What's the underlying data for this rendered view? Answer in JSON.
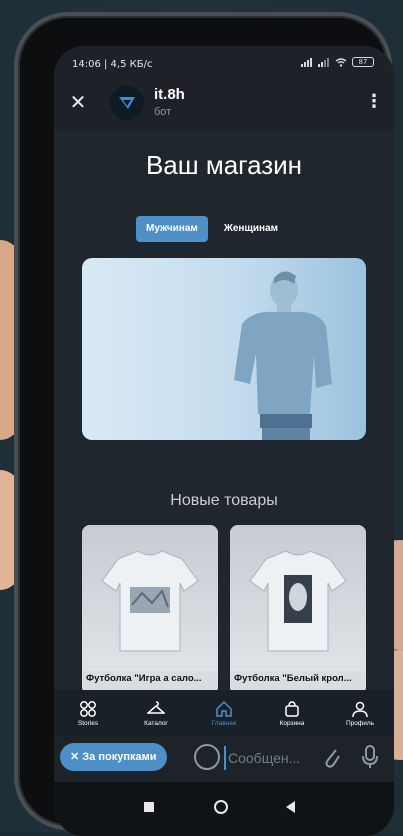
{
  "status_bar": {
    "time": "14:06 | 4,5 КБ/с",
    "battery": "87"
  },
  "header": {
    "bot_name": "it.8h",
    "bot_subtitle": "бот"
  },
  "shop": {
    "title": "Ваш магазин",
    "tabs": [
      {
        "label": "Мужчинам",
        "active": true
      },
      {
        "label": "Женщинам",
        "active": false
      }
    ],
    "section_title": "Новые товары",
    "products": [
      {
        "name": "Футболка \"Игра а сало...",
        "icon": "tshirt-image"
      },
      {
        "name": "Футболка \"Белый крол...",
        "icon": "tshirt-image"
      }
    ]
  },
  "bottom_nav": {
    "items": [
      {
        "label": "Stories",
        "icon": "grid-icon",
        "active": false
      },
      {
        "label": "Каталог",
        "icon": "hanger-icon",
        "active": false
      },
      {
        "label": "Главная",
        "icon": "home-icon",
        "active": true
      },
      {
        "label": "Корзина",
        "icon": "bag-icon",
        "active": false
      },
      {
        "label": "Профиль",
        "icon": "person-icon",
        "active": false
      }
    ]
  },
  "input_bar": {
    "purchase_button": "✕ За покупками",
    "message_placeholder": "Сообщен..."
  },
  "colors": {
    "accent": "#4f8fc8",
    "background": "#1f262d"
  }
}
